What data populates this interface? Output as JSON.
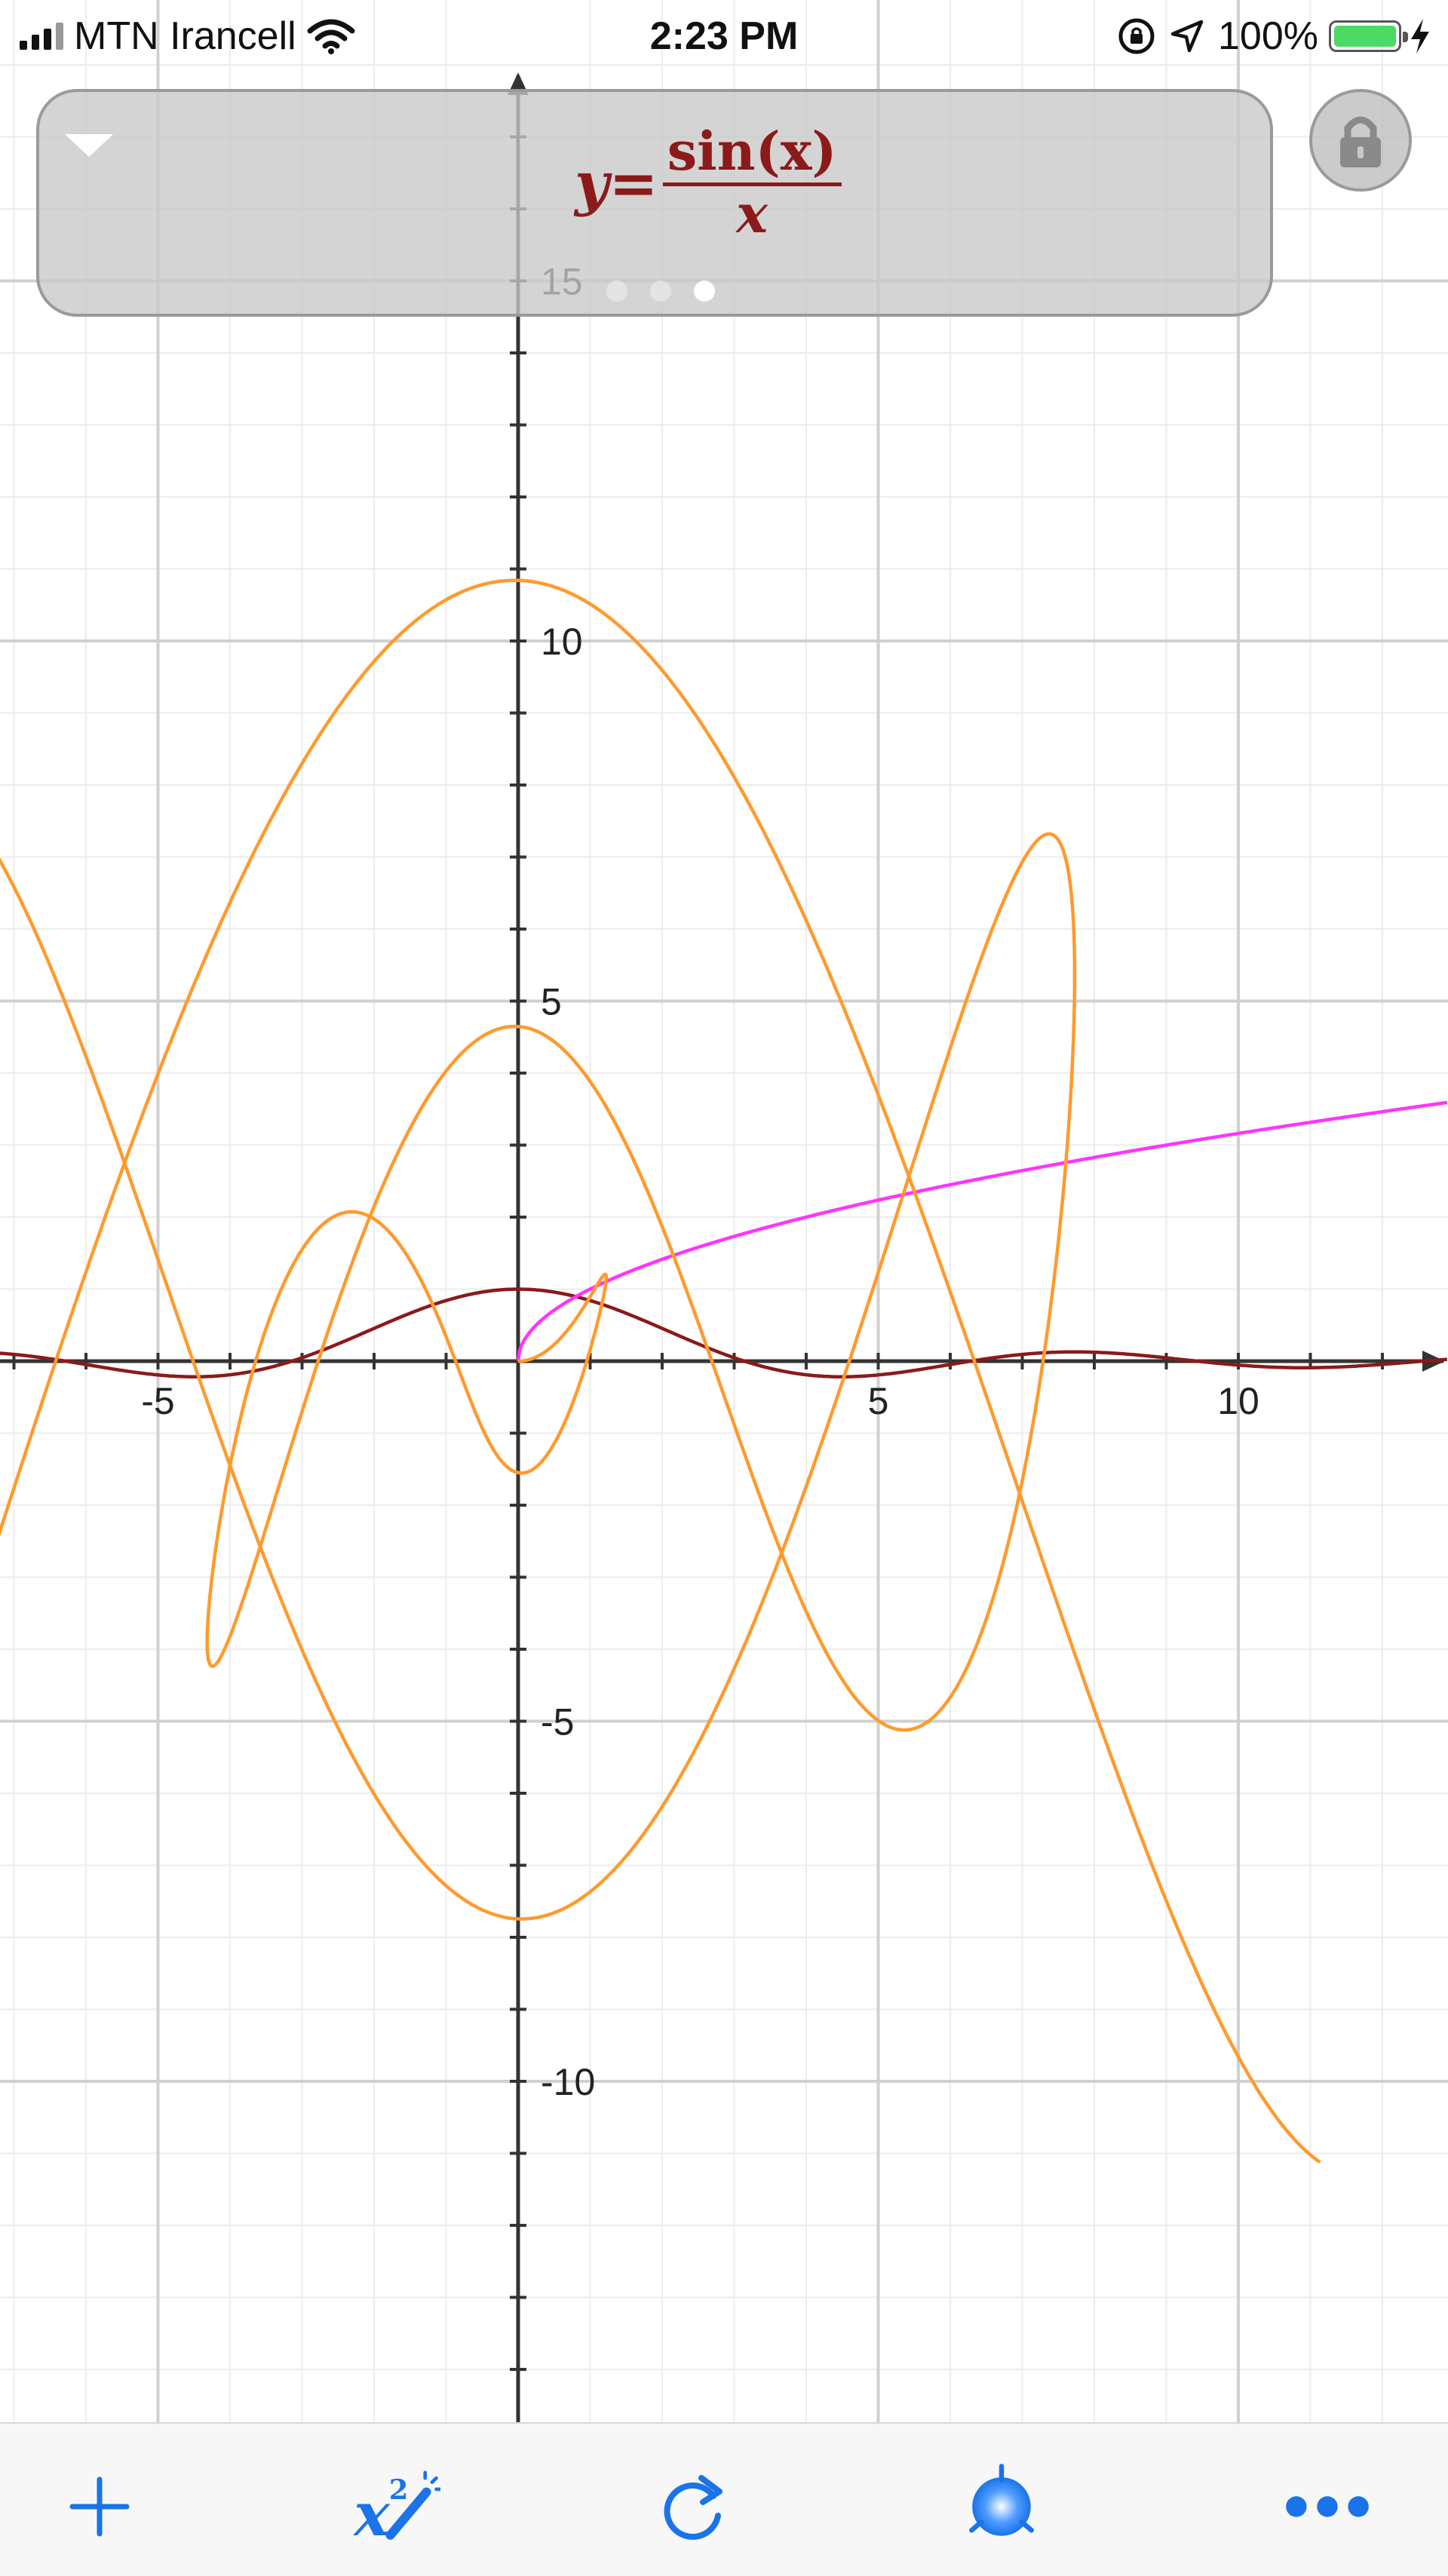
{
  "status_bar": {
    "carrier": "MTN Irancell",
    "time": "2:23 PM",
    "battery_percent": "100%"
  },
  "function_panel": {
    "formula_lhs": "y=",
    "formula_numerator": "sin(x)",
    "formula_denominator": "x",
    "pages_total": 3,
    "active_page": 3
  },
  "graph": {
    "x_ticks": [
      "-5",
      "5",
      "10"
    ],
    "y_ticks": [
      "15",
      "10",
      "5",
      "-5",
      "-10"
    ],
    "curves": [
      {
        "function": "sin(x)/x",
        "color": "#8b1a1a"
      },
      {
        "function": "sqrt(x)",
        "color": "#ff33ff"
      },
      {
        "function": "polar spiral",
        "color": "#ff9a2e"
      }
    ]
  },
  "toolbar": {
    "buttons": [
      "add-icon",
      "formula-edit-icon",
      "reset-icon",
      "theme-icon",
      "more-icon"
    ],
    "accent_color": "#1a73e8"
  },
  "colors": {
    "axis": "#333333",
    "grid_major": "#d0d0d0",
    "grid_minor": "#ececec"
  }
}
